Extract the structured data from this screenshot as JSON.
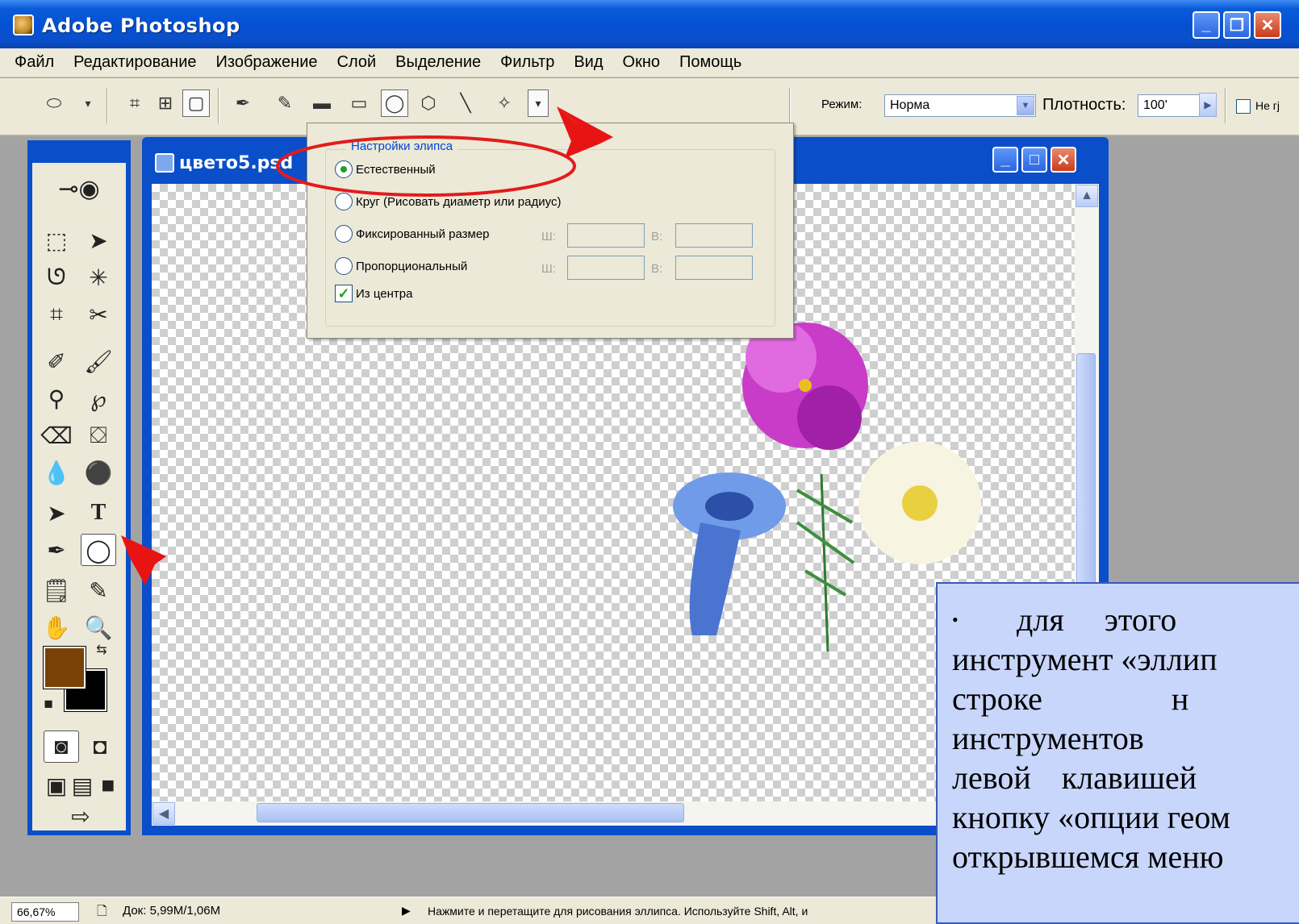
{
  "window": {
    "title": "Adobe Photoshop",
    "buttons": {
      "minimize": "_",
      "restore": "❐",
      "close": "✕"
    }
  },
  "menubar": {
    "items": [
      "Файл",
      "Редактирование",
      "Изображение",
      "Слой",
      "Выделение",
      "Фильтр",
      "Вид",
      "Окно",
      "Помощь"
    ]
  },
  "options_bar": {
    "mode_label": "Режим:",
    "mode_value": "Норма",
    "opacity_label": "Плотность:",
    "opacity_value": "100'",
    "antialias_label": "Не гј"
  },
  "document": {
    "title": "цвето5.psd"
  },
  "ellipse_options": {
    "legend": "Настройки элипса",
    "options": [
      "Естественный",
      "Круг (Рисовать диаметр или радиус)",
      "Фиксированный размер",
      "Пропорциональный"
    ],
    "selected_index": 0,
    "width_label": "Ш:",
    "height_label": "В:",
    "from_center_label": "Из центра",
    "from_center_checked": true
  },
  "statusbar": {
    "zoom": "66,67%",
    "doc_info": "Док: 5,99M/1,06M",
    "hint": "Нажмите и перетащите для рисования эллипса. Используйте Shift, Alt, и"
  },
  "note": {
    "lines": [
      "для этого",
      "инструмент «эллип",
      "строке н",
      "инструментов",
      "левой клавишей",
      "кнопку «опции геом",
      "открывшемся меню"
    ]
  },
  "colors": {
    "foreground": "#7a4106",
    "background": "#000000",
    "accent": "#0a4fc9"
  },
  "icons": [
    "ellipse-icon",
    "marquee-icon",
    "pen-icon",
    "rectangle-icon",
    "rounded-rectangle-icon",
    "ellipse-shape-icon",
    "polygon-icon",
    "line-icon",
    "custom-shape-icon",
    "dropdown-arrow-icon"
  ]
}
